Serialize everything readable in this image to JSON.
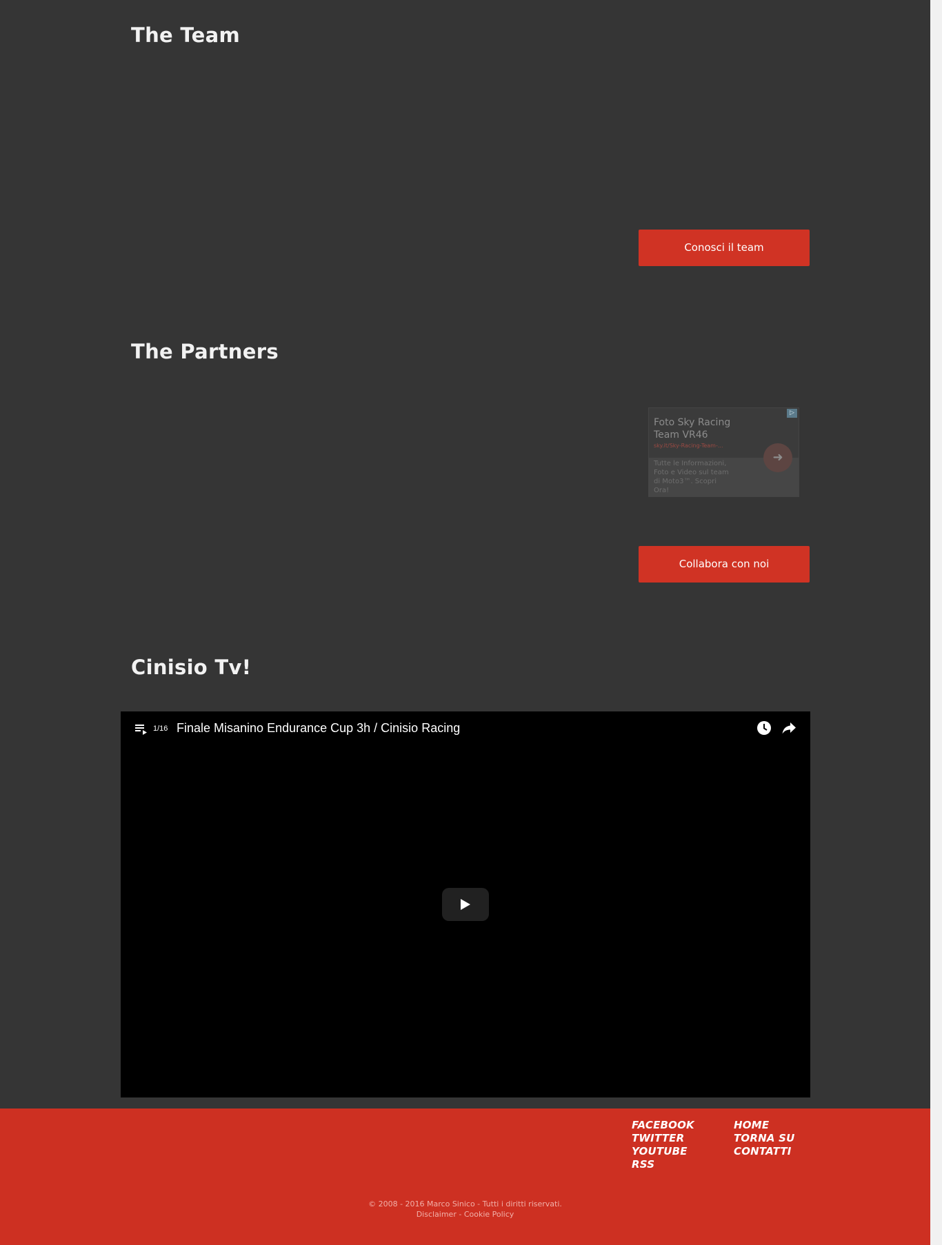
{
  "sections": {
    "team": {
      "title": "The Team",
      "button_label": "Conosci il team"
    },
    "partners": {
      "title": "The Partners",
      "button_label": "Collabora con noi"
    },
    "tv": {
      "title": "Cinisio Tv!"
    }
  },
  "ad": {
    "headline": "Foto Sky Racing Team VR46",
    "url": "sky.it/Sky-Racing-Team-...",
    "description": "Tutte le Informazioni, Foto e Video sul team di Moto3™. Scopri Ora!",
    "choices_icon": "ad-choices-icon",
    "arrow_icon": "arrow-right-icon"
  },
  "video": {
    "counter": "1/16",
    "title": "Finale Misanino Endurance Cup 3h / Cinisio Racing",
    "icons": [
      "playlist-icon",
      "watch-later-icon",
      "share-icon",
      "play-icon"
    ]
  },
  "footer": {
    "social_links": [
      "FACEBOOK",
      "TWITTER",
      "YOUTUBE",
      "RSS"
    ],
    "nav_links": [
      "HOME",
      "TORNA SU",
      "CONTATTI"
    ],
    "copyright": "© 2008 - 2016 Marco Sinico - Tutti i diritti riservati.",
    "disclaimer": "Disclaimer",
    "separator": " - ",
    "cookie_policy": "Cookie Policy"
  },
  "colors": {
    "page_background": "#353535",
    "accent_red": "#cd3022",
    "button_red": "#d03324",
    "video_background": "#000000"
  }
}
